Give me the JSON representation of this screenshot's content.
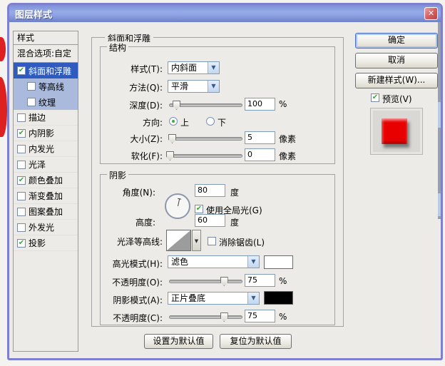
{
  "window": {
    "title": "图层样式",
    "close_glyph": "✕"
  },
  "sidebar": {
    "header": "样式",
    "blend_options": "混合选项:自定",
    "items": [
      {
        "label": "斜面和浮雕",
        "checked": true,
        "state": "selected",
        "indent": false
      },
      {
        "label": "等高线",
        "checked": false,
        "state": "hl",
        "indent": true
      },
      {
        "label": "纹理",
        "checked": false,
        "state": "hl",
        "indent": true
      },
      {
        "label": "描边",
        "checked": false,
        "state": "",
        "indent": false
      },
      {
        "label": "内阴影",
        "checked": true,
        "state": "",
        "indent": false
      },
      {
        "label": "内发光",
        "checked": false,
        "state": "",
        "indent": false
      },
      {
        "label": "光泽",
        "checked": false,
        "state": "",
        "indent": false
      },
      {
        "label": "颜色叠加",
        "checked": true,
        "state": "",
        "indent": false
      },
      {
        "label": "渐变叠加",
        "checked": false,
        "state": "",
        "indent": false
      },
      {
        "label": "图案叠加",
        "checked": false,
        "state": "",
        "indent": false
      },
      {
        "label": "外发光",
        "checked": false,
        "state": "",
        "indent": false
      },
      {
        "label": "投影",
        "checked": true,
        "state": "",
        "indent": false
      }
    ]
  },
  "main": {
    "panel_title": "斜面和浮雕",
    "structure": {
      "legend": "结构",
      "style_label": "样式(T):",
      "style_value": "内斜面",
      "technique_label": "方法(Q):",
      "technique_value": "平滑",
      "depth_label": "深度(D):",
      "depth_value": "100",
      "depth_unit": "%",
      "direction_label": "方向:",
      "direction_up": "上",
      "direction_down": "下",
      "size_label": "大小(Z):",
      "size_value": "5",
      "size_unit": "像素",
      "soften_label": "软化(F):",
      "soften_value": "0",
      "soften_unit": "像素"
    },
    "shading": {
      "legend": "阴影",
      "angle_label": "角度(N):",
      "angle_value": "80",
      "angle_unit": "度",
      "global_light_label": "使用全局光(G)",
      "altitude_label": "高度:",
      "altitude_value": "60",
      "altitude_unit": "度",
      "gloss_contour_label": "光泽等高线:",
      "anti_alias_label": "消除锯齿(L)",
      "highlight_mode_label": "高光模式(H):",
      "highlight_mode_value": "滤色",
      "highlight_color": "#ffffff",
      "highlight_opacity_label": "不透明度(O):",
      "highlight_opacity_value": "75",
      "highlight_opacity_unit": "%",
      "shadow_mode_label": "阴影模式(A):",
      "shadow_mode_value": "正片叠底",
      "shadow_color": "#000000",
      "shadow_opacity_label": "不透明度(C):",
      "shadow_opacity_value": "75",
      "shadow_opacity_unit": "%"
    },
    "footer": {
      "set_default": "设置为默认值",
      "reset_default": "复位为默认值"
    }
  },
  "actions": {
    "ok": "确定",
    "cancel": "取消",
    "new_style": "新建样式(W)...",
    "preview_label": "预览(V)",
    "preview_checked": true
  },
  "slider_values": {
    "depth_pct": 9,
    "size_pct": 3,
    "soften_pct": 0,
    "highlight_opacity_pct": 75,
    "shadow_opacity_pct": 75
  },
  "colors": {
    "selection_blue": "#2f5bc0",
    "child_selection_blue": "#a9badc",
    "titlebar_blue": "#8096d8",
    "preview_object_red": "#e80000"
  }
}
